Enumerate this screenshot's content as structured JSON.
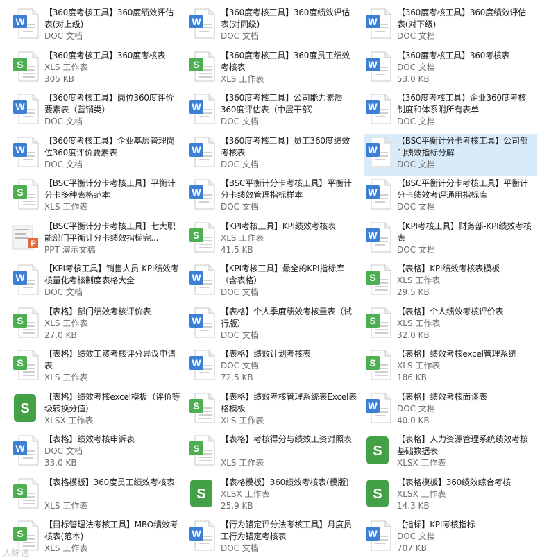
{
  "colors": {
    "doc_accent": "#3e7fd6",
    "xls_accent": "#4caf50",
    "xlsx_accent": "#43a047",
    "ppt_accent": "#e36c3c",
    "selection_bg": "#d9ebf9"
  },
  "files": [
    {
      "name": "【360度考核工具】360度绩效评估表(对上级)",
      "type": "DOC 文档",
      "size": "",
      "icon": "doc"
    },
    {
      "name": "【360度考核工具】360度绩效评估表(对同级)",
      "type": "DOC 文档",
      "size": "",
      "icon": "doc"
    },
    {
      "name": "【360度考核工具】360度绩效评估表(对下级)",
      "type": "DOC 文档",
      "size": "",
      "icon": "doc"
    },
    {
      "name": "【360度考核工具】360度考核表",
      "type": "XLS 工作表",
      "size": "305 KB",
      "icon": "xls",
      "one_line": true
    },
    {
      "name": "【360度考核工具】360度员工绩效考核表",
      "type": "XLS 工作表",
      "size": "",
      "icon": "xls"
    },
    {
      "name": "【360度考核工具】360考核表",
      "type": "DOC 文档",
      "size": "53.0 KB",
      "icon": "doc",
      "one_line": true
    },
    {
      "name": "【360度考核工具】岗位360度评价要素表（营销类）",
      "type": "DOC 文档",
      "size": "",
      "icon": "doc"
    },
    {
      "name": "【360度考核工具】公司能力素质360度评估表（中层干部）",
      "type": "DOC 文档",
      "size": "",
      "icon": "doc"
    },
    {
      "name": "【360度考核工具】企业360度考核制度和体系附所有表单",
      "type": "DOC 文档",
      "size": "",
      "icon": "doc"
    },
    {
      "name": "【360度考核工具】企业基层管理岗位360度评价要素表",
      "type": "DOC 文档",
      "size": "",
      "icon": "doc"
    },
    {
      "name": "【360度考核工具】员工360度绩效考核表",
      "type": "DOC 文档",
      "size": "",
      "icon": "doc"
    },
    {
      "name": "【BSC平衡计分卡考核工具】公司部门绩效指标分解",
      "type": "DOC 文档",
      "size": "",
      "icon": "doc",
      "selected": true
    },
    {
      "name": "【BSC平衡计分卡考核工具】平衡计分卡多种表格范本",
      "type": "XLS 工作表",
      "size": "",
      "icon": "xls"
    },
    {
      "name": "【BSC平衡计分卡考核工具】平衡计分卡绩效管理指标样本",
      "type": "DOC 文档",
      "size": "",
      "icon": "doc"
    },
    {
      "name": "【BSC平衡计分卡考核工具】平衡计分卡绩效考评通用指标库",
      "type": "DOC 文档",
      "size": "",
      "icon": "doc"
    },
    {
      "name": "【BSC平衡计分卡考核工具】七大职能部门平衡计分卡绩效指标完...",
      "type": "PPT 演示文稿",
      "size": "",
      "icon": "ppt"
    },
    {
      "name": "【KPI考核工具】KPI绩效考核表",
      "type": "XLS 工作表",
      "size": "41.5 KB",
      "icon": "xls",
      "one_line": true
    },
    {
      "name": "【KPI考核工具】财务部-KPI绩效考核表",
      "type": "DOC 文档",
      "size": "",
      "icon": "doc"
    },
    {
      "name": "【KPI考核工具】销售人员-KPI绩效考核量化考核制度表格大全",
      "type": "DOC 文档",
      "size": "",
      "icon": "doc"
    },
    {
      "name": "【KPI考核工具】最全的KPI指标库（含表格）",
      "type": "DOC 文档",
      "size": "",
      "icon": "doc"
    },
    {
      "name": "【表格】KPI绩效考核表模板",
      "type": "XLS 工作表",
      "size": "29.5 KB",
      "icon": "xls",
      "one_line": true
    },
    {
      "name": "【表格】部门绩效考核评价表",
      "type": "XLS 工作表",
      "size": "27.0 KB",
      "icon": "xls",
      "one_line": true
    },
    {
      "name": "【表格】个人季度绩效考核量表（试行版）",
      "type": "DOC 文档",
      "size": "",
      "icon": "doc"
    },
    {
      "name": "【表格】个人绩效考核评价表",
      "type": "XLS 工作表",
      "size": "32.0 KB",
      "icon": "xls",
      "one_line": true
    },
    {
      "name": "【表格】绩效工资考核评分异议申请表",
      "type": "XLS 工作表",
      "size": "",
      "icon": "xls"
    },
    {
      "name": "【表格】绩效计划考核表",
      "type": "DOC 文档",
      "size": "72.5 KB",
      "icon": "doc",
      "one_line": true
    },
    {
      "name": "【表格】绩效考核excel管理系统",
      "type": "XLS 工作表",
      "size": "186 KB",
      "icon": "xls",
      "one_line": true
    },
    {
      "name": "【表格】绩效考核excel模板（评价等级转换分值）",
      "type": "XLSX 工作表",
      "size": "",
      "icon": "xlsx"
    },
    {
      "name": "【表格】绩效考核管理系统表Excel表格模板",
      "type": "XLS 工作表",
      "size": "",
      "icon": "xls"
    },
    {
      "name": "【表格】绩效考核面谈表",
      "type": "DOC 文档",
      "size": "40.0 KB",
      "icon": "doc",
      "one_line": true
    },
    {
      "name": "【表格】绩效考核申诉表",
      "type": "DOC 文档",
      "size": "33.0 KB",
      "icon": "doc",
      "one_line": true
    },
    {
      "name": "【表格】考核得分与绩效工资对照表",
      "type": "XLS 工作表",
      "size": "",
      "icon": "xls"
    },
    {
      "name": "【表格】人力资源管理系统绩效考核基础数据表",
      "type": "XLSX 工作表",
      "size": "",
      "icon": "xlsx"
    },
    {
      "name": "【表格模板】360度员工绩效考核表",
      "type": "XLS 工作表",
      "size": "",
      "icon": "xls"
    },
    {
      "name": "【表格模板】360绩效考核表(模版)",
      "type": "XLSX 工作表",
      "size": "25.9 KB",
      "icon": "xlsx",
      "one_line": true
    },
    {
      "name": "【表格模板】360绩效综合考核",
      "type": "XLSX 工作表",
      "size": "14.3 KB",
      "icon": "xlsx",
      "one_line": true
    },
    {
      "name": "【目标管理法考核工具】MBO绩效考核表(范本)",
      "type": "XLS 工作表",
      "size": "",
      "icon": "xls"
    },
    {
      "name": "【行为锚定评分法考核工具】月度员工行为锚定考核表",
      "type": "DOC 文档",
      "size": "",
      "icon": "doc"
    },
    {
      "name": "【指标】KPI考核指标",
      "type": "DOC 文档",
      "size": "707 KB",
      "icon": "doc",
      "one_line": true
    }
  ],
  "watermark": "人脉通"
}
